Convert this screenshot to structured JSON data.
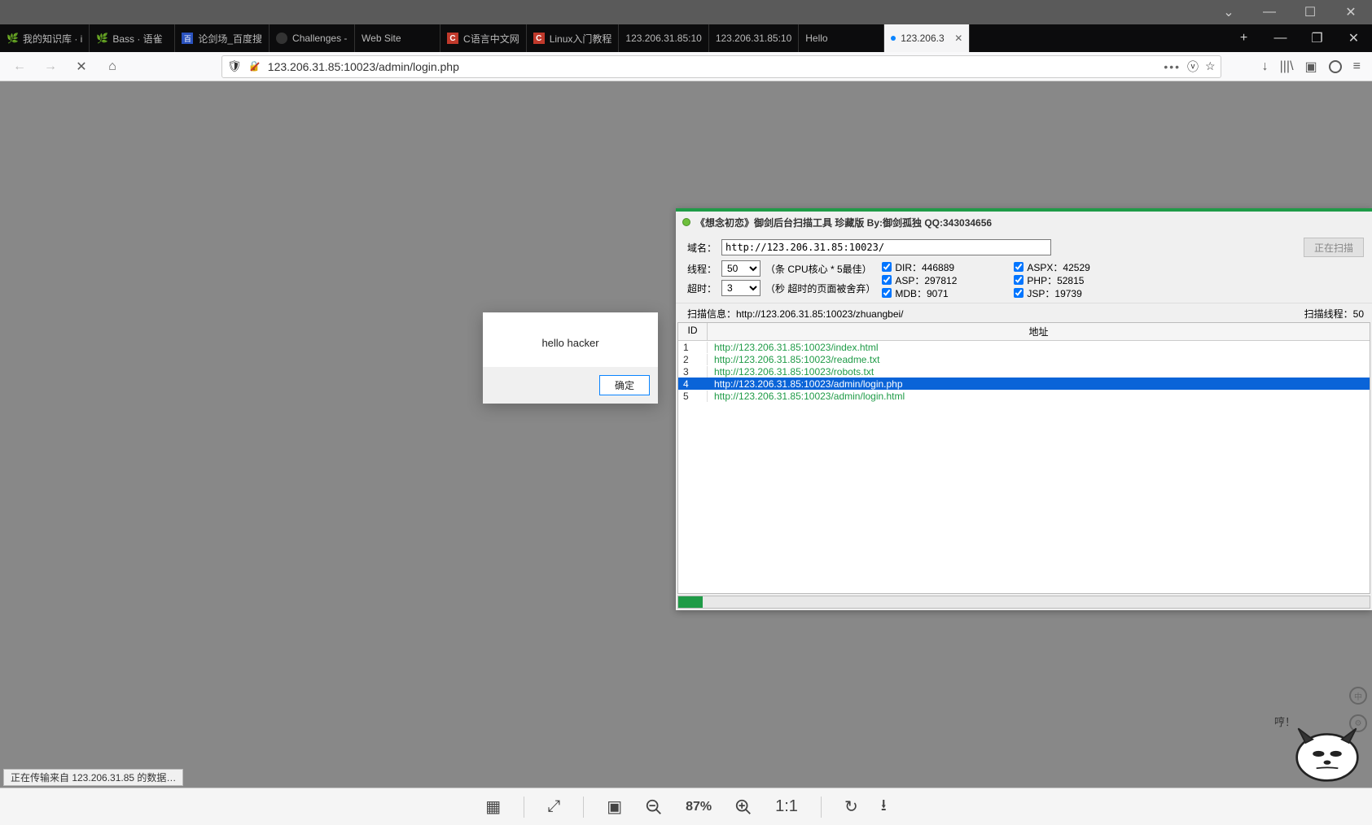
{
  "outer_window": {
    "chevron": "⌄",
    "minimize": "—",
    "maximize": "☐",
    "close": "✕"
  },
  "tabs": [
    {
      "label": "我的知识库 · i",
      "icon": "leaf"
    },
    {
      "label": "Bass · 语雀",
      "icon": "leaf"
    },
    {
      "label": "论剑场_百度搜",
      "icon": "baidu"
    },
    {
      "label": "Challenges - ",
      "icon": "dark"
    },
    {
      "label": "Web Site",
      "icon": "none"
    },
    {
      "label": "C语言中文网",
      "icon": "red-c"
    },
    {
      "label": "Linux入门教程",
      "icon": "red-c"
    },
    {
      "label": "123.206.31.85:10",
      "icon": "none"
    },
    {
      "label": "123.206.31.85:10",
      "icon": "none"
    },
    {
      "label": "Hello",
      "icon": "none"
    },
    {
      "label": "123.206.3",
      "icon": "dot",
      "active": true,
      "closable": true
    }
  ],
  "tab_actions": {
    "add": "+",
    "minimize": "—",
    "restore": "❐",
    "close": "✕"
  },
  "nav": {
    "back": "←",
    "forward": "→",
    "stop": "✕",
    "home": "⌂",
    "shield": "🛡",
    "url": "123.206.31.85:10023/admin/login.php",
    "dots": "•••",
    "pocket": "⌄",
    "star": "☆",
    "download": "↓",
    "library": "|||\\",
    "sidebar": "▣",
    "account": "◯",
    "menu": "≡"
  },
  "alert": {
    "message": "hello hacker",
    "ok": "确定"
  },
  "scanner": {
    "title": "《想念初恋》御剑后台扫描工具 珍藏版 By:御剑孤独 QQ:343034656",
    "domain_label": "域名：",
    "domain_value": "http://123.206.31.85:10023/",
    "thread_label": "线程：",
    "thread_value": "50",
    "thread_hint": "（条 CPU核心 * 5最佳）",
    "timeout_label": "超时：",
    "timeout_value": "3",
    "timeout_hint": "（秒 超时的页面被舍弃）",
    "scan_btn": "正在扫描",
    "checkboxes": {
      "dir": "DIR：446889",
      "aspx": "ASPX：42529",
      "asp": "ASP：297812",
      "php": "PHP：52815",
      "mdb": "MDB：9071",
      "jsp": "JSP：19739"
    },
    "scan_info_left": "扫描信息：http://123.206.31.85:10023/zhuangbei/",
    "scan_info_right": "扫描线程：50",
    "col_id": "ID",
    "col_url": "地址",
    "rows": [
      {
        "id": "1",
        "url": "http://123.206.31.85:10023/index.html"
      },
      {
        "id": "2",
        "url": "http://123.206.31.85:10023/readme.txt"
      },
      {
        "id": "3",
        "url": "http://123.206.31.85:10023/robots.txt"
      },
      {
        "id": "4",
        "url": "http://123.206.31.85:10023/admin/login.php",
        "selected": true
      },
      {
        "id": "5",
        "url": "http://123.206.31.85:10023/admin/login.html"
      }
    ]
  },
  "statusbar": "正在传输来自 123.206.31.85 的数据…",
  "bottom_toolbar": {
    "zoom_text": "87%"
  },
  "bubble": "哼！"
}
